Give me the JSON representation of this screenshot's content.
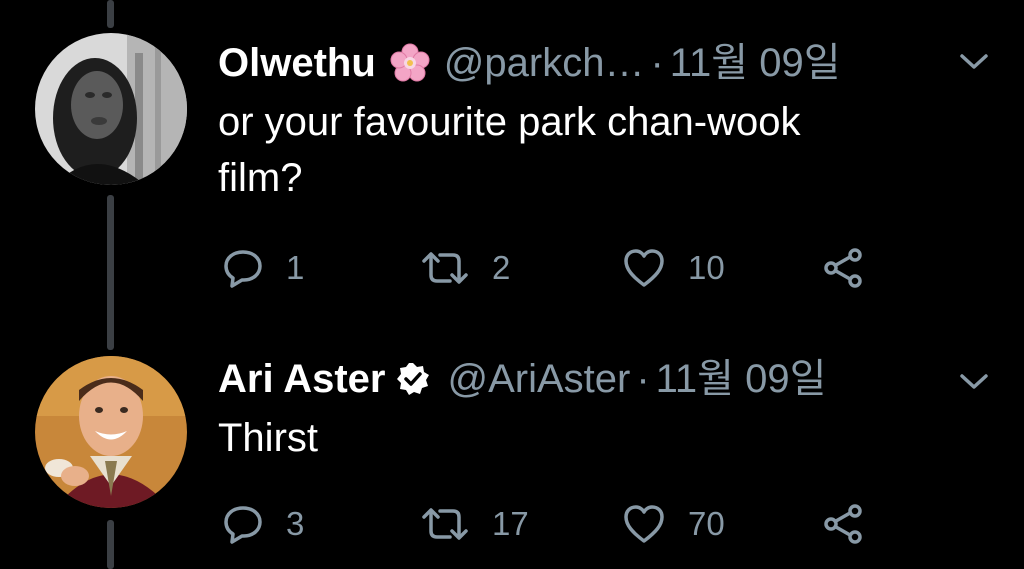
{
  "colors": {
    "background": "#000000",
    "text": "#ffffff",
    "muted": "#8899a6",
    "thread_line": "#3b3f44"
  },
  "tweets": [
    {
      "name": "Olwethu",
      "name_icon": "cherry-blossom-icon",
      "handle": "@parkch…",
      "separator": "·",
      "date": "11월 09일",
      "text_lines": [
        "or your favourite park chan-wook",
        "film?"
      ],
      "replies": "1",
      "retweets": "2",
      "likes": "10"
    },
    {
      "name": "Ari Aster",
      "name_icon": "verified-badge-icon",
      "handle": "@AriAster",
      "separator": "·",
      "date": "11월 09일",
      "text_lines": [
        "Thirst"
      ],
      "replies": "3",
      "retweets": "17",
      "likes": "70"
    }
  ]
}
